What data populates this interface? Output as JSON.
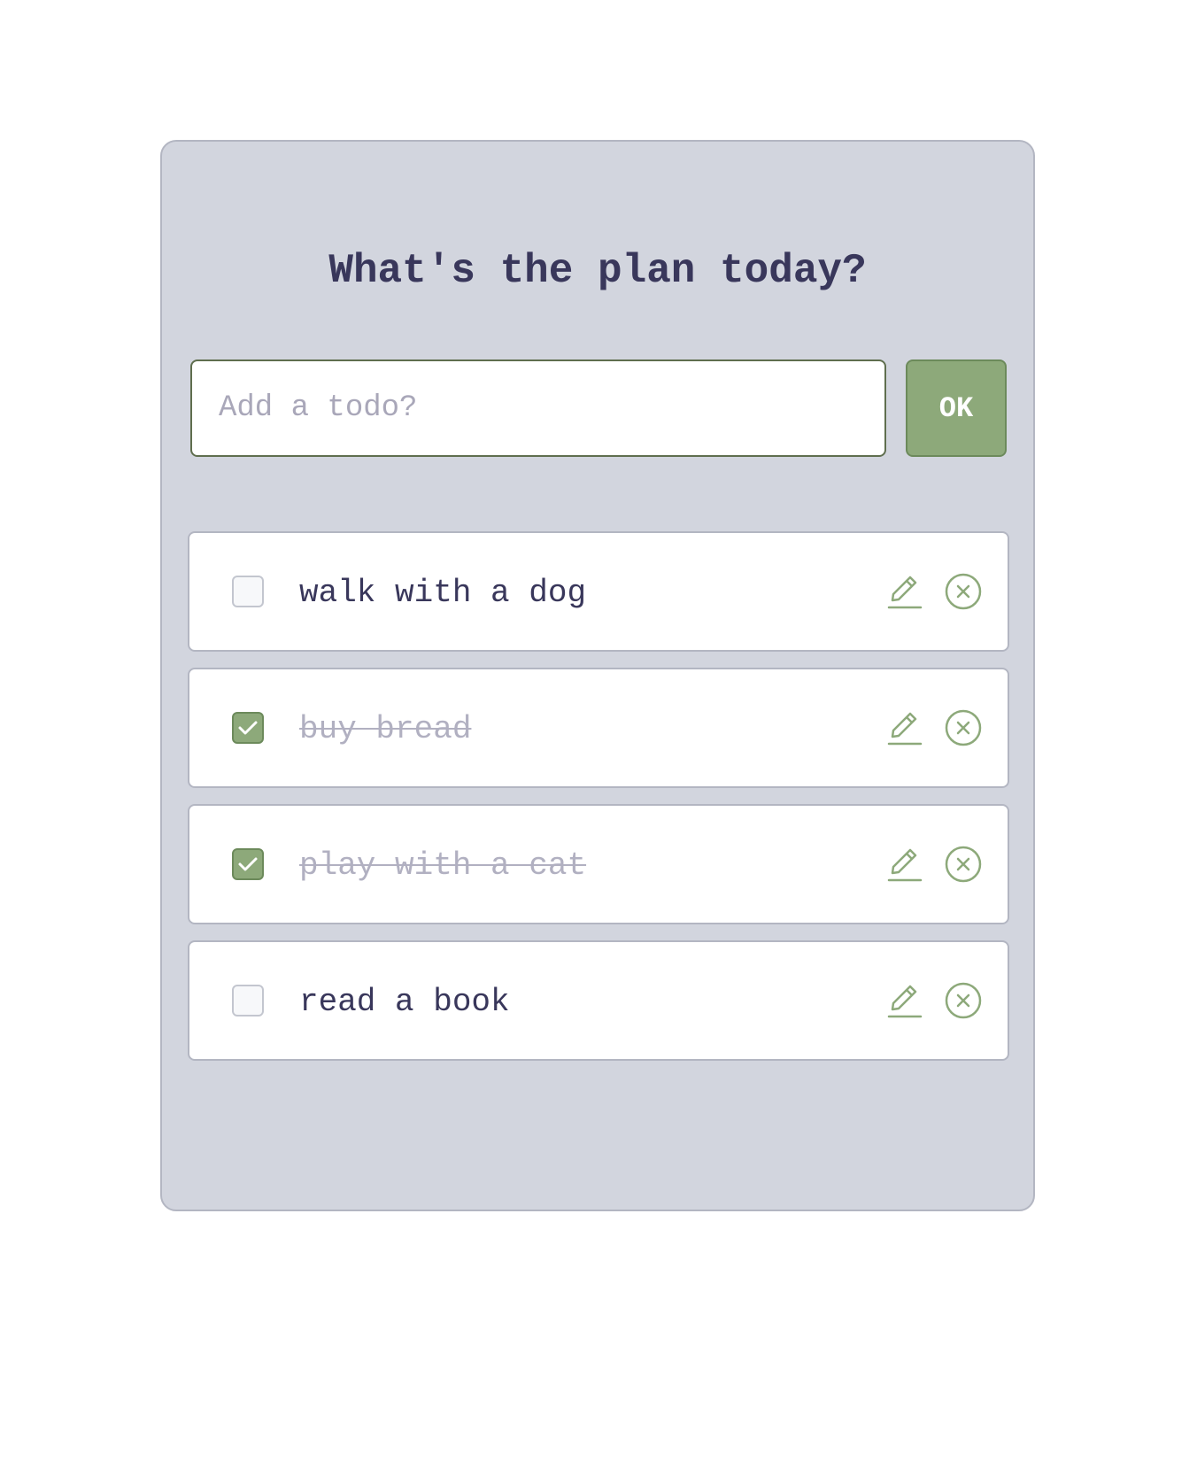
{
  "header": {
    "title": "What's the plan today?"
  },
  "form": {
    "placeholder": "Add a todo?",
    "value": "",
    "submit_label": "OK"
  },
  "todos": [
    {
      "text": "walk with a dog",
      "completed": false
    },
    {
      "text": "buy bread",
      "completed": true
    },
    {
      "text": "play with a cat",
      "completed": true
    },
    {
      "text": "read a book",
      "completed": false
    }
  ],
  "icons": {
    "edit": "pencil-icon",
    "delete": "close-circle-icon",
    "check": "checkmark-icon"
  },
  "colors": {
    "accent": "#8da97a",
    "title": "#39375b",
    "card_background": "#d2d5de",
    "done_text": "#b1b0c1"
  }
}
